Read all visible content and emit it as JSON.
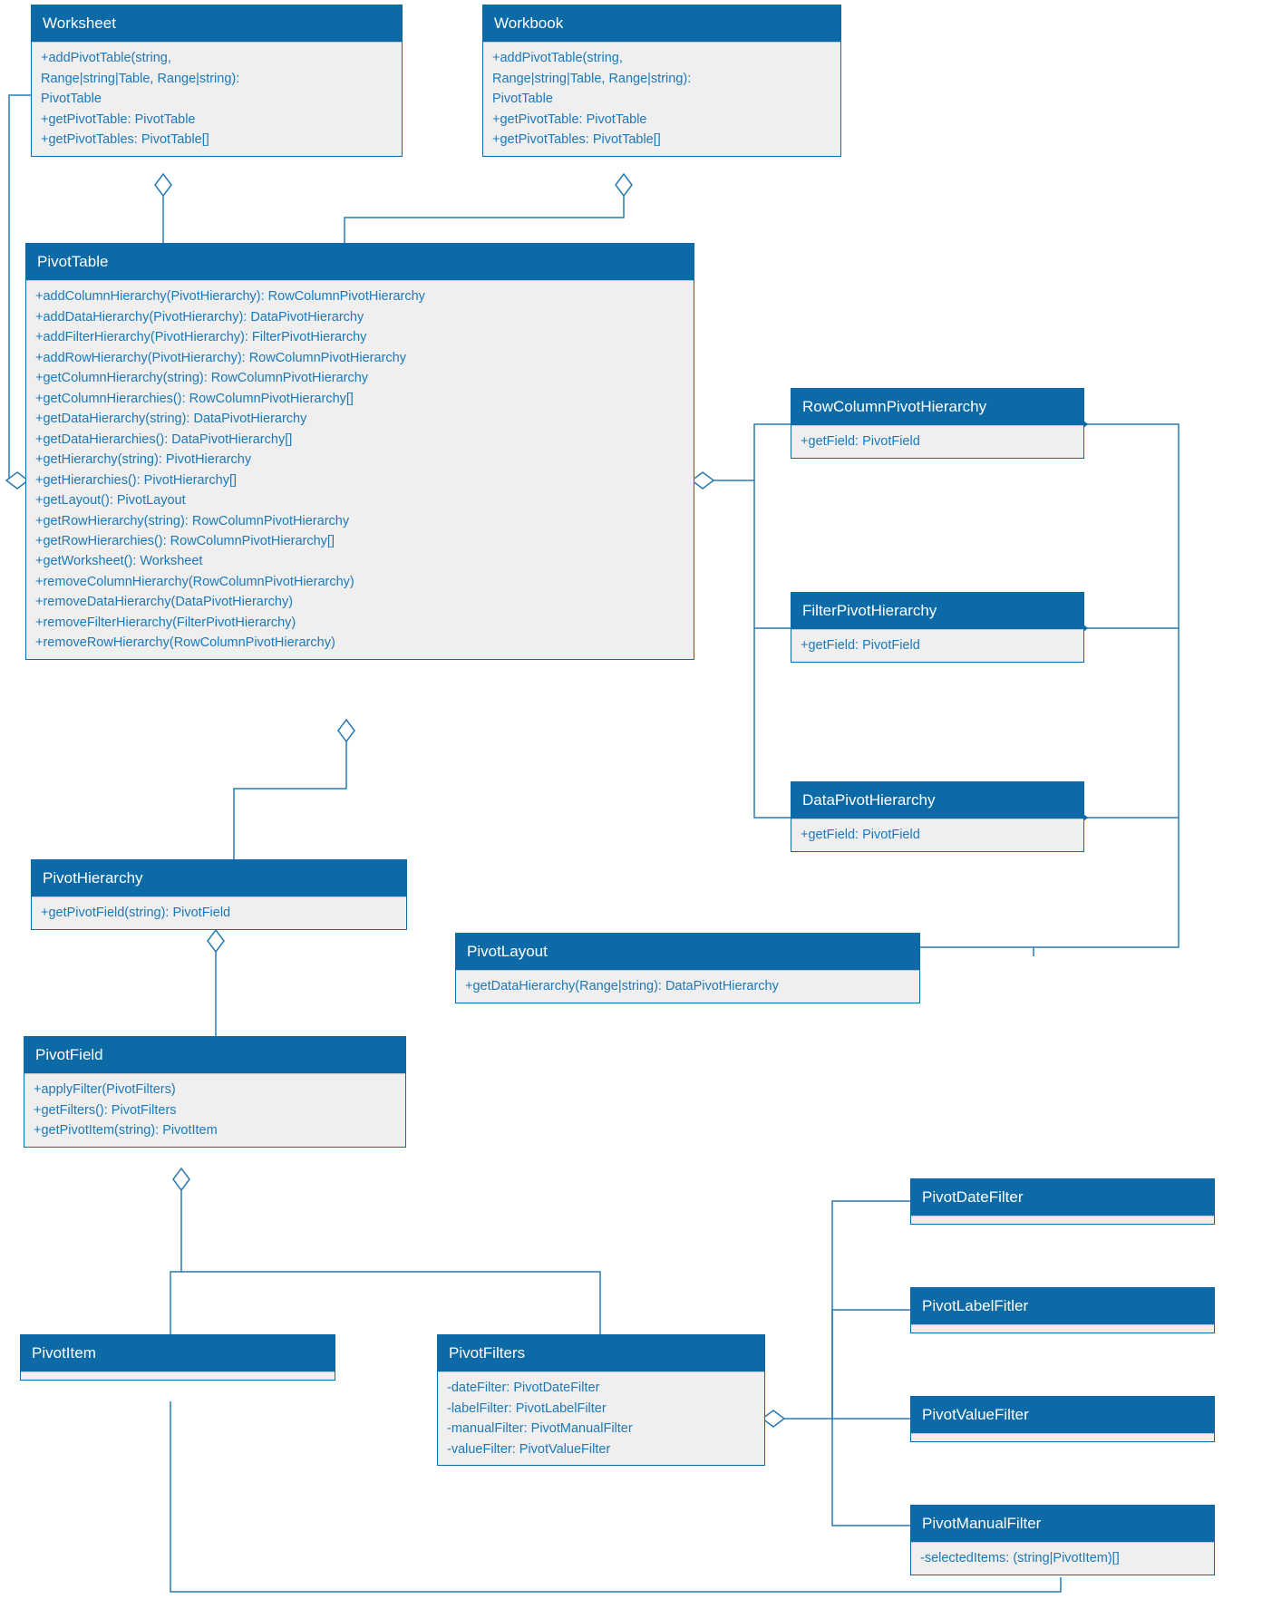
{
  "diagram": {
    "colors": {
      "header": "#0c6aa6",
      "body_bg": "#efefef",
      "text": "#1c79b9",
      "line": "#2a7ab0"
    },
    "classes": {
      "worksheet": {
        "name": "Worksheet",
        "members": [
          "+addPivotTable(string,",
          "Range|string|Table, Range|string):",
          "PivotTable",
          "+getPivotTable: PivotTable",
          "+getPivotTables: PivotTable[]"
        ]
      },
      "workbook": {
        "name": "Workbook",
        "members": [
          "+addPivotTable(string,",
          "Range|string|Table, Range|string):",
          "PivotTable",
          "+getPivotTable: PivotTable",
          "+getPivotTables: PivotTable[]"
        ]
      },
      "pivottable": {
        "name": "PivotTable",
        "members": [
          "+addColumnHierarchy(PivotHierarchy): RowColumnPivotHierarchy",
          "+addDataHierarchy(PivotHierarchy): DataPivotHierarchy",
          "+addFilterHierarchy(PivotHierarchy): FilterPivotHierarchy",
          "+addRowHierarchy(PivotHierarchy): RowColumnPivotHierarchy",
          "+getColumnHierarchy(string): RowColumnPivotHierarchy",
          "+getColumnHierarchies(): RowColumnPivotHierarchy[]",
          "+getDataHierarchy(string): DataPivotHierarchy",
          "+getDataHierarchies(): DataPivotHierarchy[]",
          "+getHierarchy(string): PivotHierarchy",
          "+getHierarchies(): PivotHierarchy[]",
          "+getLayout(): PivotLayout",
          "+getRowHierarchy(string): RowColumnPivotHierarchy",
          "+getRowHierarchies(): RowColumnPivotHierarchy[]",
          "+getWorksheet(): Worksheet",
          "+removeColumnHierarchy(RowColumnPivotHierarchy)",
          "+removeDataHierarchy(DataPivotHierarchy)",
          "+removeFilterHierarchy(FilterPivotHierarchy)",
          "+removeRowHierarchy(RowColumnPivotHierarchy)"
        ]
      },
      "rowcol": {
        "name": "RowColumnPivotHierarchy",
        "members": [
          "+getField: PivotField"
        ]
      },
      "filterh": {
        "name": "FilterPivotHierarchy",
        "members": [
          "+getField: PivotField"
        ]
      },
      "datah": {
        "name": "DataPivotHierarchy",
        "members": [
          "+getField: PivotField"
        ]
      },
      "pivothier": {
        "name": "PivotHierarchy",
        "members": [
          "+getPivotField(string): PivotField"
        ]
      },
      "pivotlayout": {
        "name": "PivotLayout",
        "members": [
          "+getDataHierarchy(Range|string): DataPivotHierarchy"
        ]
      },
      "pivotfield": {
        "name": "PivotField",
        "members": [
          "+applyFilter(PivotFilters)",
          "+getFilters(): PivotFilters",
          "+getPivotItem(string): PivotItem"
        ]
      },
      "pivotitem": {
        "name": "PivotItem",
        "members": []
      },
      "pivotfilters": {
        "name": "PivotFilters",
        "members": [
          "-dateFilter: PivotDateFilter",
          "-labelFilter: PivotLabelFilter",
          "-manualFilter: PivotManualFilter",
          "-valueFilter: PivotValueFilter"
        ]
      },
      "datefilter": {
        "name": "PivotDateFilter",
        "members": []
      },
      "labelfilter": {
        "name": "PivotLabelFitler",
        "members": []
      },
      "valuefilter": {
        "name": "PivotValueFilter",
        "members": []
      },
      "manualfilter": {
        "name": "PivotManualFilter",
        "members": [
          "-selectedItems: (string|PivotItem)[]"
        ]
      }
    },
    "relationships": [
      {
        "from": "Worksheet",
        "to": "PivotTable",
        "type": "aggregation"
      },
      {
        "from": "Workbook",
        "to": "PivotTable",
        "type": "aggregation"
      },
      {
        "from": "PivotTable",
        "to": "PivotHierarchy",
        "type": "aggregation"
      },
      {
        "from": "PivotTable",
        "to": "RowColumnPivotHierarchy",
        "type": "aggregation"
      },
      {
        "from": "PivotTable",
        "to": "FilterPivotHierarchy",
        "type": "aggregation"
      },
      {
        "from": "PivotTable",
        "to": "DataPivotHierarchy",
        "type": "aggregation"
      },
      {
        "from": "Worksheet",
        "to": "PivotTable",
        "type": "association-left"
      },
      {
        "from": "PivotHierarchy",
        "to": "PivotField",
        "type": "aggregation"
      },
      {
        "from": "PivotField",
        "to": "PivotItem",
        "type": "aggregation"
      },
      {
        "from": "PivotField",
        "to": "PivotFilters",
        "type": "aggregation"
      },
      {
        "from": "PivotTable",
        "to": "PivotLayout",
        "type": "association"
      },
      {
        "from": "RowColumnPivotHierarchy",
        "to": "PivotField",
        "type": "composition"
      },
      {
        "from": "FilterPivotHierarchy",
        "to": "PivotField",
        "type": "composition"
      },
      {
        "from": "DataPivotHierarchy",
        "to": "PivotField",
        "type": "composition"
      },
      {
        "from": "PivotFilters",
        "to": "PivotDateFilter",
        "type": "aggregation"
      },
      {
        "from": "PivotFilters",
        "to": "PivotLabelFitler",
        "type": "aggregation"
      },
      {
        "from": "PivotFilters",
        "to": "PivotValueFilter",
        "type": "aggregation"
      },
      {
        "from": "PivotFilters",
        "to": "PivotManualFilter",
        "type": "aggregation"
      },
      {
        "from": "PivotManualFilter",
        "to": "PivotItem",
        "type": "association"
      }
    ]
  }
}
